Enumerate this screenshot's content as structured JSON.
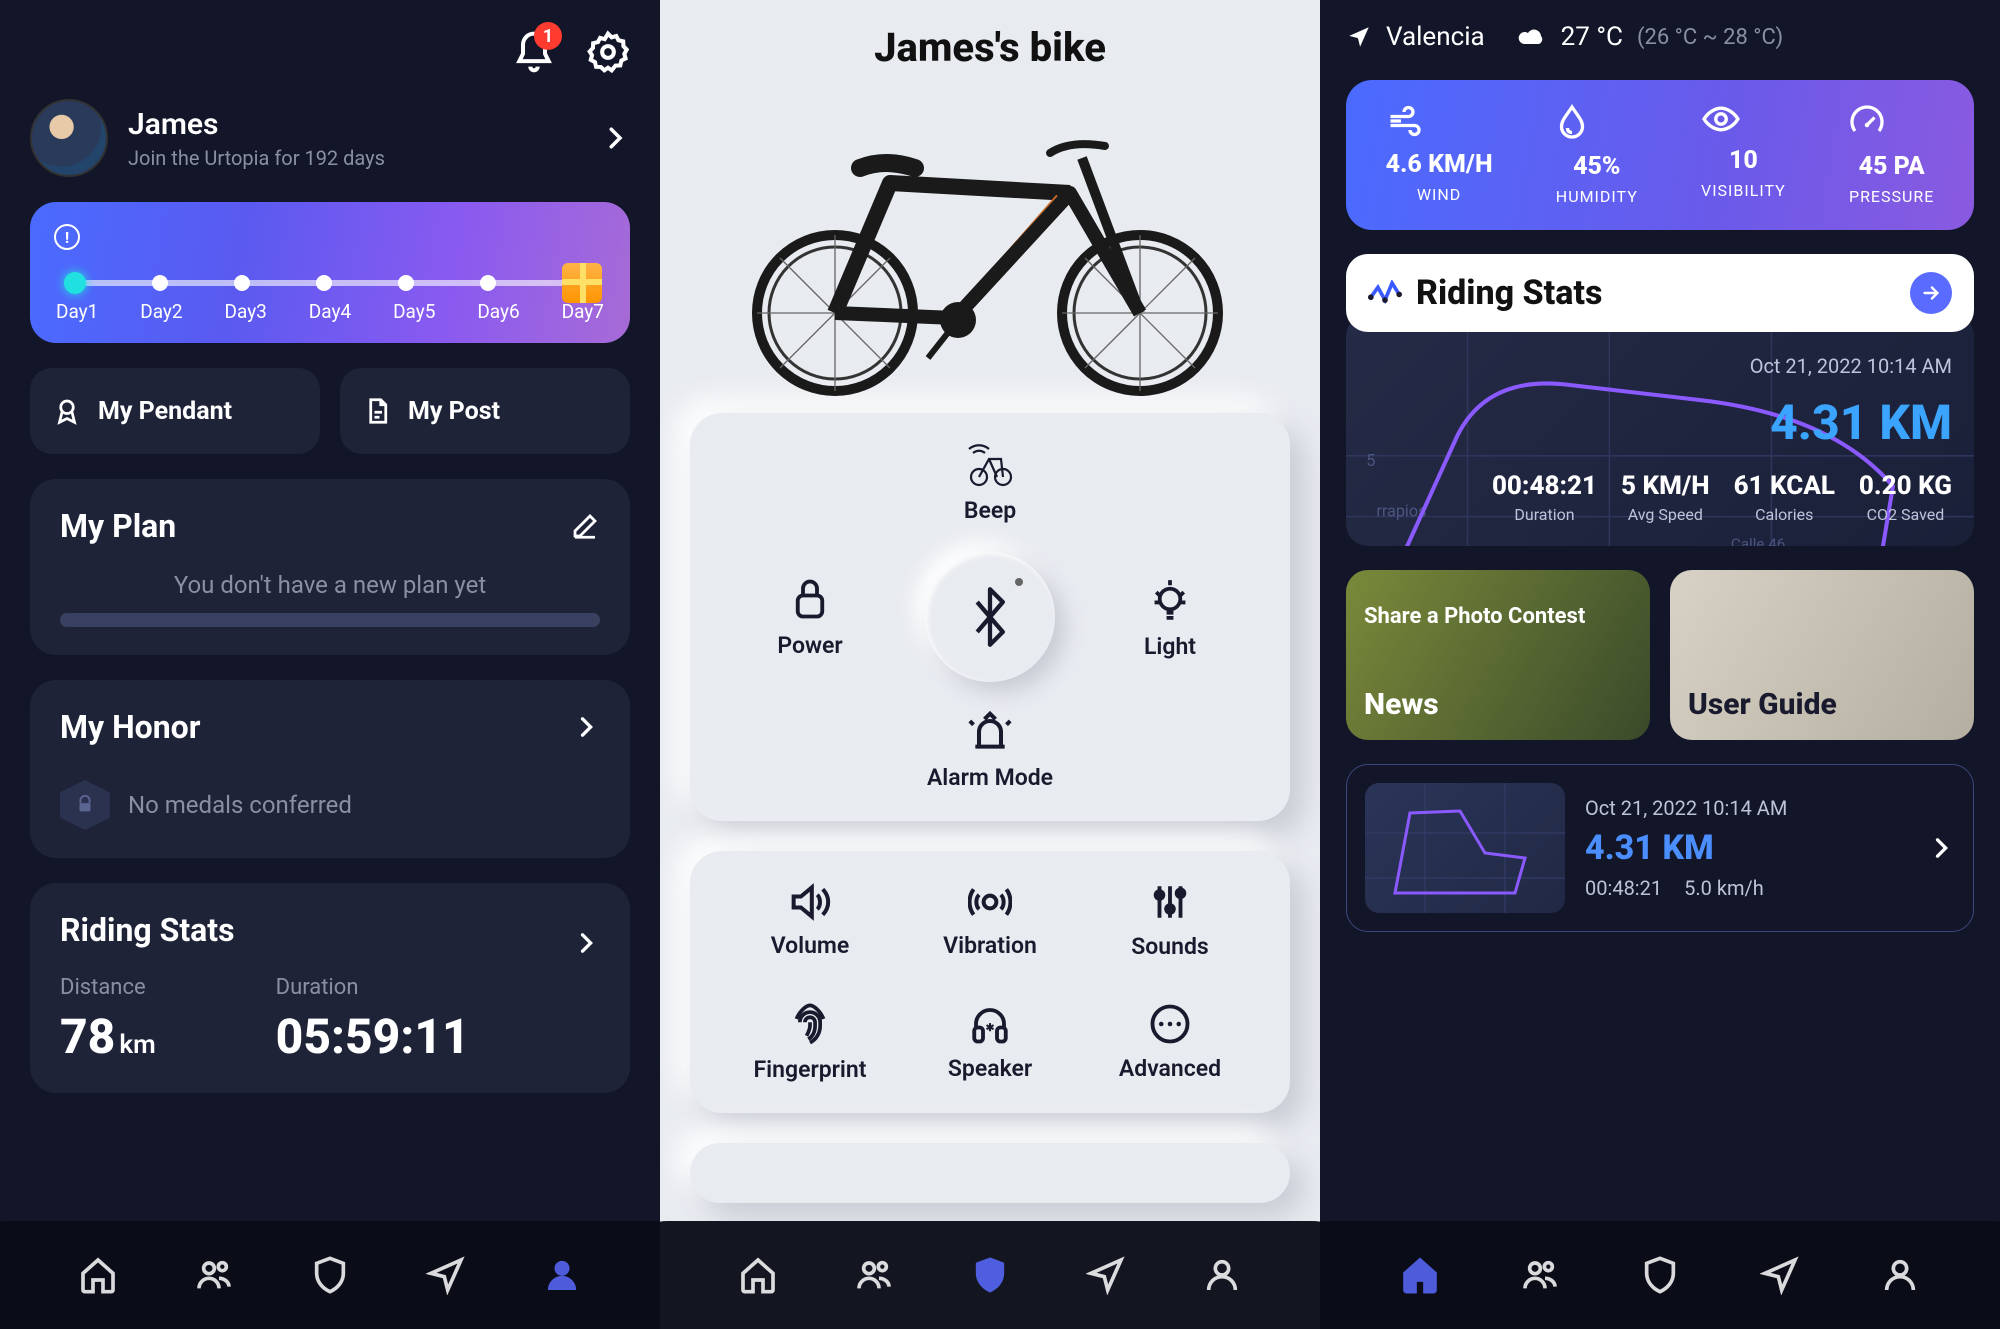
{
  "screen1": {
    "notif_count": "1",
    "user": {
      "name": "James",
      "subtitle": "Join the Urtopia for 192 days"
    },
    "days": [
      "Day1",
      "Day2",
      "Day3",
      "Day4",
      "Day5",
      "Day6",
      "Day7"
    ],
    "my_pendant": "My Pendant",
    "my_post": "My Post",
    "plan": {
      "title": "My Plan",
      "empty": "You don't have a new plan yet"
    },
    "honor": {
      "title": "My Honor",
      "empty": "No medals conferred"
    },
    "riding": {
      "title": "Riding Stats",
      "distance_label": "Distance",
      "distance_value": "78",
      "distance_unit": "km",
      "duration_label": "Duration",
      "duration_value": "05:59:11"
    }
  },
  "screen2": {
    "title": "James's bike",
    "controls": {
      "beep": "Beep",
      "power": "Power",
      "light": "Light",
      "alarm": "Alarm Mode",
      "volume": "Volume",
      "vibration": "Vibration",
      "sounds": "Sounds",
      "fingerprint": "Fingerprint",
      "speaker": "Speaker",
      "advanced": "Advanced"
    }
  },
  "screen3": {
    "location": "Valencia",
    "temp": "27 °C",
    "range": "(26 °C ~ 28 °C)",
    "weather": {
      "wind": {
        "value": "4.6 KM/H",
        "label": "WIND"
      },
      "humidity": {
        "value": "45%",
        "label": "HUMIDITY"
      },
      "visibility": {
        "value": "10",
        "label": "VISIBILITY"
      },
      "pressure": {
        "value": "45 PA",
        "label": "PRESSURE"
      }
    },
    "riding_stats_title": "Riding Stats",
    "ride_summary": {
      "date": "Oct 21, 2022 10:14 AM",
      "distance": "4.31 KM",
      "duration": {
        "value": "00:48:21",
        "label": "Duration"
      },
      "avg_speed": {
        "value": "5 KM/H",
        "label": "Avg Speed"
      },
      "calories": {
        "value": "61 KCAL",
        "label": "Calories"
      },
      "co2": {
        "value": "0.20 KG",
        "label": "CO2 Saved"
      }
    },
    "tiles": {
      "news_sub": "Share a Photo Contest",
      "news": "News",
      "guide": "User Guide"
    },
    "ride_card": {
      "date": "Oct 21, 2022 10:14 AM",
      "distance": "4.31 KM",
      "duration": "00:48:21",
      "speed": "5.0 km/h"
    }
  }
}
